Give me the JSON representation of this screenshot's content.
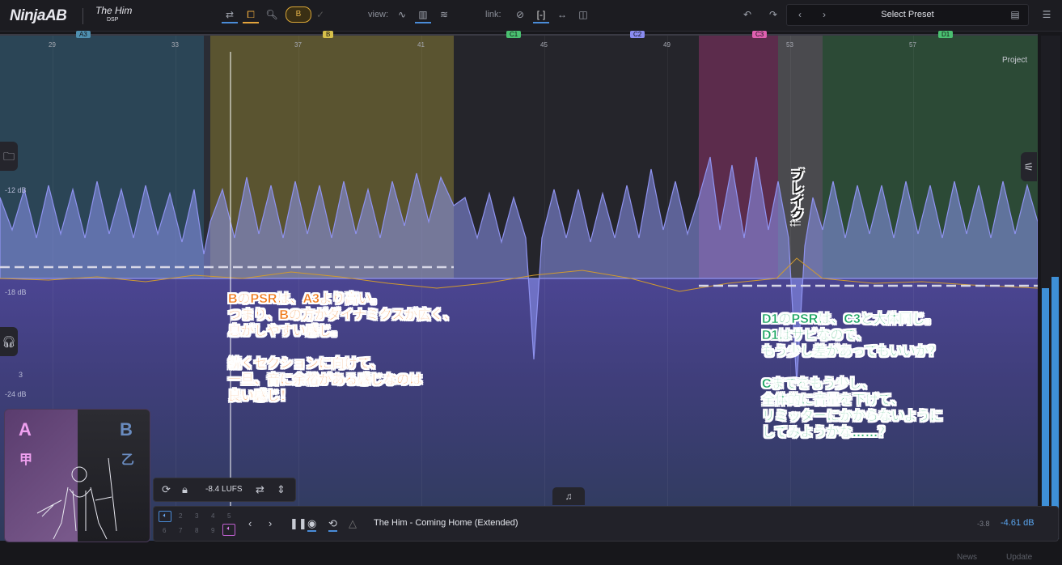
{
  "header": {
    "logo": "NinjaAB",
    "logo2": "The Him",
    "logo2_sub": "DSP",
    "ab_pill": "B",
    "view_label": "view:",
    "link_label": "link:",
    "preset": "Select Preset"
  },
  "markers": [
    "A3",
    "B",
    "C1",
    "C2",
    "C3",
    "D1"
  ],
  "marker_colors": [
    "#2f6f8f",
    "#c9b33a",
    "#3aa85a",
    "#6f6fd8",
    "#d04fa0",
    "#3aa85a"
  ],
  "bars": [
    "29",
    "33",
    "37",
    "41",
    "45",
    "49",
    "53",
    "57"
  ],
  "project_label": "Project",
  "db_labels": [
    "-12 dB",
    "-18 dB",
    "-24 dB",
    "3"
  ],
  "annotations": {
    "left": [
      "BのPSRは、A3より高い。",
      "つまり、Bの方がダイナミクスが広く、",
      "息がしやすい感じ。",
      "",
      "続くセクションに向けて、",
      "一旦、音に余裕がある感じなのは",
      "良い感じ！"
    ],
    "right": [
      "D1のPSRは、C3と大体同じ。",
      "D1はサビなので、",
      "もう少し差があってもいいか？",
      "",
      "Cまでをもう少し、",
      "全体的に音量を下げて、",
      "リミッターにかからないように",
      "してみようかな……？"
    ],
    "break": "ブレイク↓"
  },
  "ab_panel": {
    "a": "A",
    "a_sub": "甲",
    "b": "B",
    "b_sub": "乙"
  },
  "lufs": "-8.4 LUFS",
  "transport": {
    "slots_top": [
      "2",
      "3",
      "4",
      "5"
    ],
    "slots_bottom": [
      "6",
      "7",
      "8",
      "9"
    ],
    "song": "The Him - Coming Home (Extended)",
    "db_small": "-3.8",
    "db_main": "-4.61 dB"
  },
  "footer": {
    "news": "News",
    "update": "Update"
  }
}
